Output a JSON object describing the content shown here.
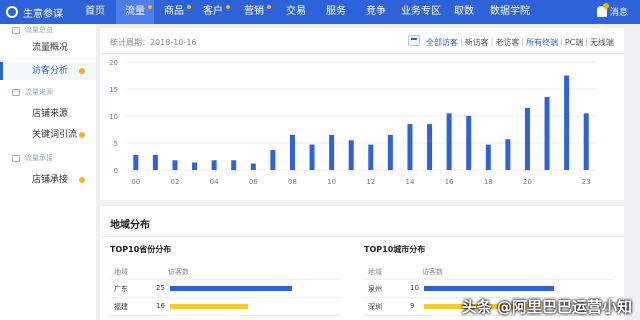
{
  "header": {
    "app_title": "生意参谋",
    "nav": [
      {
        "label": "首页",
        "dot": false,
        "active": false
      },
      {
        "label": "流量",
        "dot": true,
        "active": true
      },
      {
        "label": "商品",
        "dot": true,
        "active": false
      },
      {
        "label": "客户",
        "dot": true,
        "active": false
      },
      {
        "label": "营销",
        "dot": true,
        "active": false
      },
      {
        "label": "交易",
        "dot": false,
        "active": false
      },
      {
        "label": "服务",
        "dot": false,
        "active": false
      },
      {
        "label": "竞争",
        "dot": false,
        "active": false
      },
      {
        "label": "业务专区",
        "dot": false,
        "active": false
      },
      {
        "label": "取数",
        "dot": false,
        "active": false
      },
      {
        "label": "数据学院",
        "dot": false,
        "active": false
      }
    ],
    "message_label": "消息"
  },
  "sidebar": {
    "group_top": "流量总览",
    "overview": "流量概况",
    "visitor_analysis": "访客分析",
    "group_source": "流量来源",
    "shop_source": "店铺来源",
    "keyword": "关键词引流",
    "group_carry": "流量承接",
    "shop_carry": "店铺承接"
  },
  "trend": {
    "period_label": "统计周期：",
    "period_value": "2018-10-16",
    "filters": [
      "全部访客",
      "新访客",
      "老访客",
      "所有终端",
      "PC端",
      "无线端"
    ],
    "active_filters": [
      0,
      3
    ]
  },
  "chart_data": {
    "type": "bar",
    "x": [
      0,
      1,
      2,
      3,
      4,
      5,
      6,
      7,
      8,
      9,
      10,
      11,
      12,
      13,
      14,
      15,
      16,
      17,
      18,
      19,
      20,
      21,
      22,
      23
    ],
    "values": [
      2.8,
      2.8,
      1.8,
      1.4,
      1.8,
      1.8,
      1.2,
      3.7,
      6.5,
      4.7,
      6.5,
      5.5,
      4.7,
      6.5,
      8.5,
      8.5,
      10.5,
      10,
      4.7,
      5.7,
      11.5,
      13.5,
      17.5,
      10.5
    ],
    "ylim": [
      0,
      20
    ],
    "yticks": [
      "0",
      "5",
      "10",
      "15",
      "20"
    ],
    "xticks": [
      "00",
      "02",
      "04",
      "06",
      "08",
      "10",
      "12",
      "14",
      "16",
      "18",
      "20",
      "23"
    ],
    "bar_color": "#2e62d9",
    "grid": true
  },
  "geo": {
    "title": "地域分布",
    "province": {
      "title": "TOP10省份分布",
      "col_region": "地域",
      "col_count": "访客数",
      "rows": [
        {
          "name": "广东",
          "value": 25,
          "color": "#2e62d9"
        },
        {
          "name": "福建",
          "value": 16,
          "color": "#f5cc31"
        }
      ]
    },
    "city": {
      "title": "TOP10城市分布",
      "col_region": "地域",
      "col_count": "访客数",
      "rows": [
        {
          "name": "泉州",
          "value": 10,
          "color": "#2e62d9"
        },
        {
          "name": "深圳",
          "value": 9,
          "color": "#f5cc31"
        }
      ]
    }
  },
  "watermark": "头条 @阿里巴巴运营小知"
}
